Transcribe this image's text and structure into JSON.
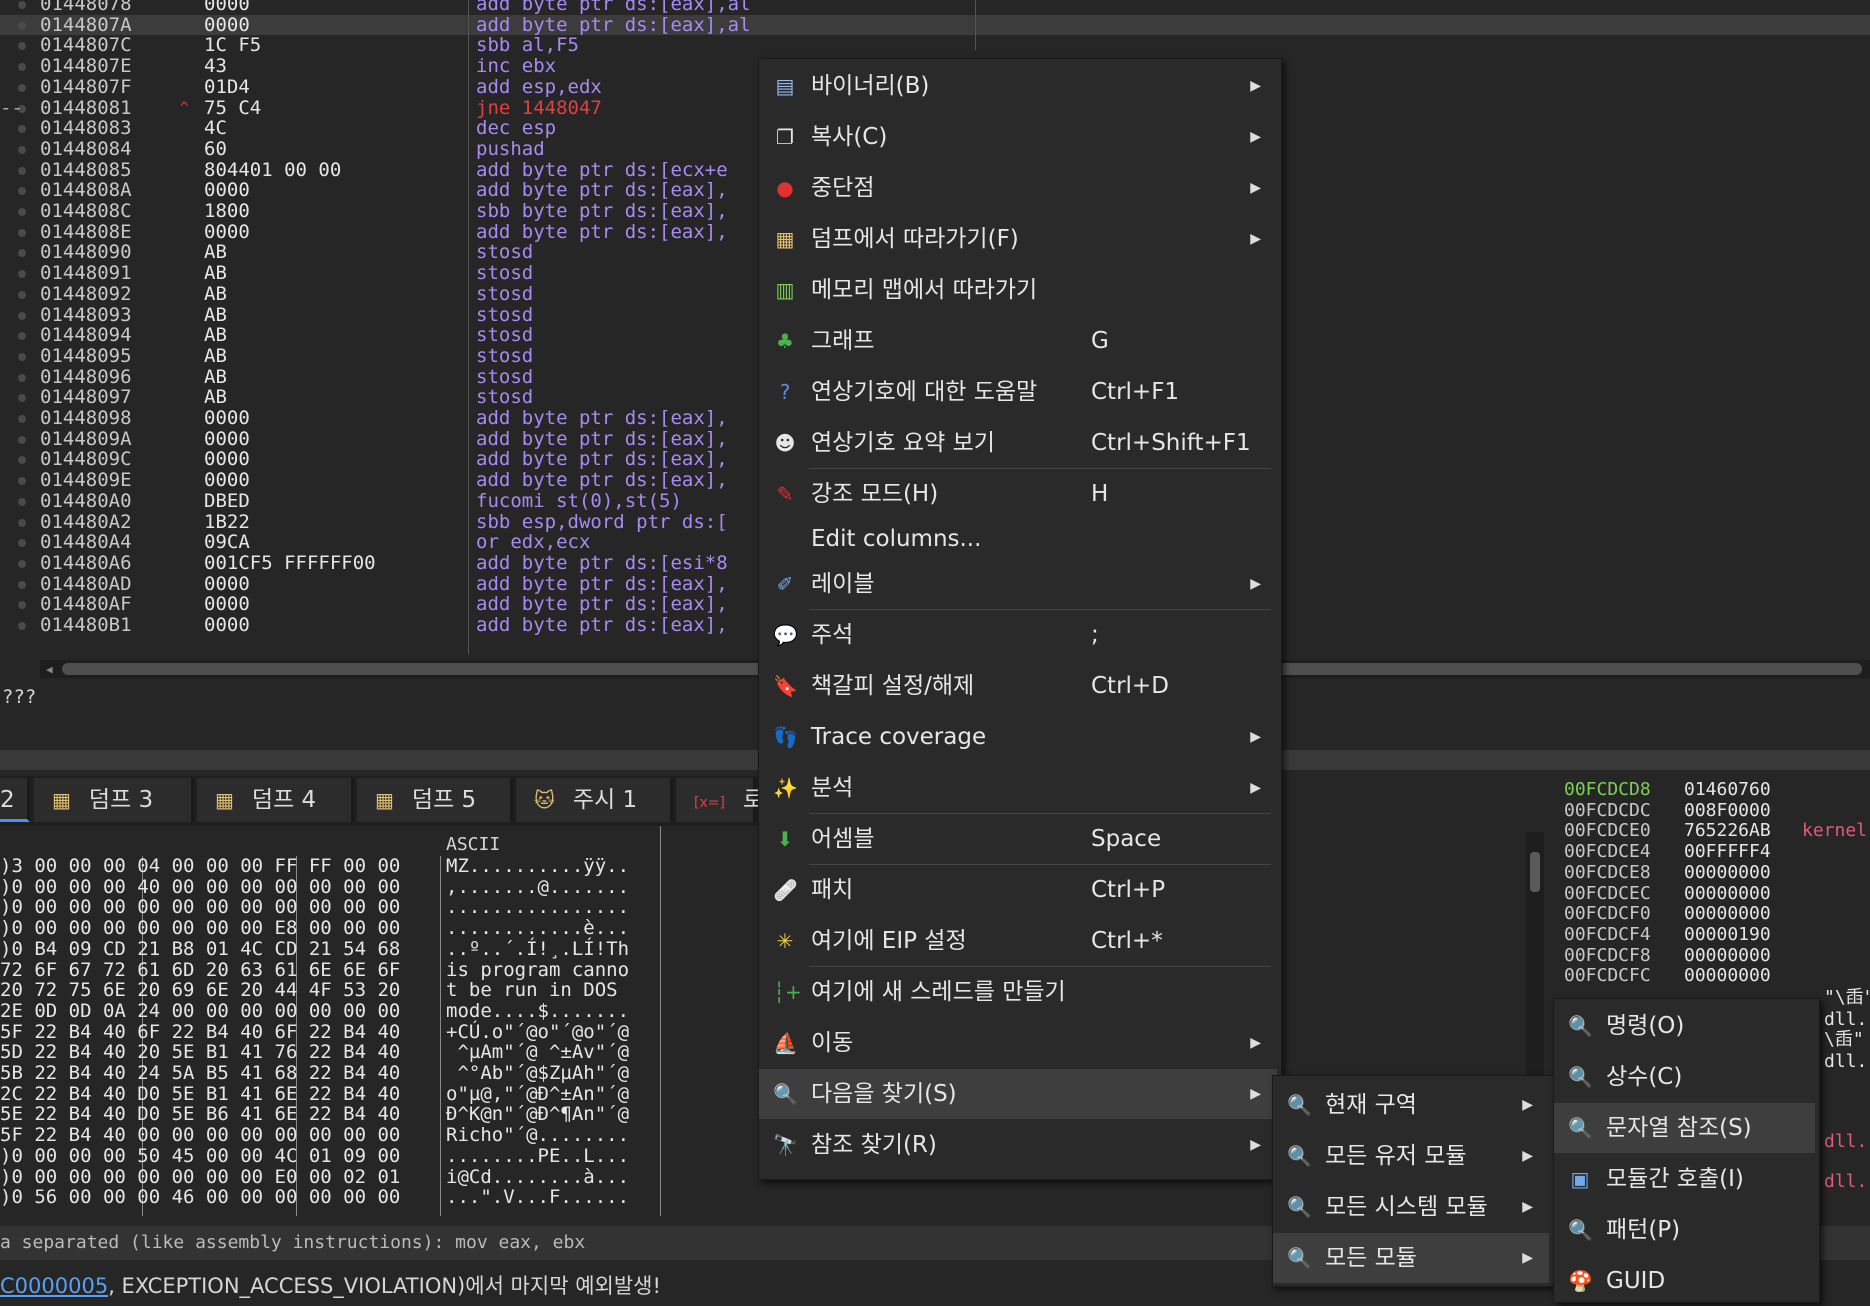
{
  "disassembly": {
    "rows": [
      {
        "addr": "01448078",
        "bytes": "0000",
        "instr": "add byte ptr ds:[eax],al",
        "selected": false,
        "gutter": "",
        "arrow": "",
        "red": false
      },
      {
        "addr": "0144807A",
        "bytes": "0000",
        "instr": "add byte ptr ds:[eax],al",
        "selected": true,
        "gutter": "",
        "arrow": "",
        "red": false
      },
      {
        "addr": "0144807C",
        "bytes": "1C F5",
        "instr": "sbb al,F5",
        "selected": false,
        "gutter": "",
        "arrow": "",
        "red": false
      },
      {
        "addr": "0144807E",
        "bytes": "43",
        "instr": "inc ebx",
        "selected": false,
        "gutter": "",
        "arrow": "",
        "red": false
      },
      {
        "addr": "0144807F",
        "bytes": "01D4",
        "instr": "add esp,edx",
        "selected": false,
        "gutter": "",
        "arrow": "",
        "red": false
      },
      {
        "addr": "01448081",
        "bytes": "75 C4",
        "instr": "jne 1448047",
        "selected": false,
        "gutter": "--",
        "arrow": "^",
        "red": true
      },
      {
        "addr": "01448083",
        "bytes": "4C",
        "instr": "dec esp",
        "selected": false,
        "gutter": "",
        "arrow": "",
        "red": false
      },
      {
        "addr": "01448084",
        "bytes": "60",
        "instr": "pushad",
        "selected": false,
        "gutter": "",
        "arrow": "",
        "red": false
      },
      {
        "addr": "01448085",
        "bytes": "804401 00 00",
        "instr": "add byte ptr ds:[ecx+e",
        "selected": false,
        "gutter": "",
        "arrow": "",
        "red": false
      },
      {
        "addr": "0144808A",
        "bytes": "0000",
        "instr": "add byte ptr ds:[eax],",
        "selected": false,
        "gutter": "",
        "arrow": "",
        "red": false
      },
      {
        "addr": "0144808C",
        "bytes": "1800",
        "instr": "sbb byte ptr ds:[eax],",
        "selected": false,
        "gutter": "",
        "arrow": "",
        "red": false
      },
      {
        "addr": "0144808E",
        "bytes": "0000",
        "instr": "add byte ptr ds:[eax],",
        "selected": false,
        "gutter": "",
        "arrow": "",
        "red": false
      },
      {
        "addr": "01448090",
        "bytes": "AB",
        "instr": "stosd",
        "selected": false,
        "gutter": "",
        "arrow": "",
        "red": false
      },
      {
        "addr": "01448091",
        "bytes": "AB",
        "instr": "stosd",
        "selected": false,
        "gutter": "",
        "arrow": "",
        "red": false
      },
      {
        "addr": "01448092",
        "bytes": "AB",
        "instr": "stosd",
        "selected": false,
        "gutter": "",
        "arrow": "",
        "red": false
      },
      {
        "addr": "01448093",
        "bytes": "AB",
        "instr": "stosd",
        "selected": false,
        "gutter": "",
        "arrow": "",
        "red": false
      },
      {
        "addr": "01448094",
        "bytes": "AB",
        "instr": "stosd",
        "selected": false,
        "gutter": "",
        "arrow": "",
        "red": false
      },
      {
        "addr": "01448095",
        "bytes": "AB",
        "instr": "stosd",
        "selected": false,
        "gutter": "",
        "arrow": "",
        "red": false
      },
      {
        "addr": "01448096",
        "bytes": "AB",
        "instr": "stosd",
        "selected": false,
        "gutter": "",
        "arrow": "",
        "red": false
      },
      {
        "addr": "01448097",
        "bytes": "AB",
        "instr": "stosd",
        "selected": false,
        "gutter": "",
        "arrow": "",
        "red": false
      },
      {
        "addr": "01448098",
        "bytes": "0000",
        "instr": "add byte ptr ds:[eax],",
        "selected": false,
        "gutter": "",
        "arrow": "",
        "red": false
      },
      {
        "addr": "0144809A",
        "bytes": "0000",
        "instr": "add byte ptr ds:[eax],",
        "selected": false,
        "gutter": "",
        "arrow": "",
        "red": false
      },
      {
        "addr": "0144809C",
        "bytes": "0000",
        "instr": "add byte ptr ds:[eax],",
        "selected": false,
        "gutter": "",
        "arrow": "",
        "red": false
      },
      {
        "addr": "0144809E",
        "bytes": "0000",
        "instr": "add byte ptr ds:[eax],",
        "selected": false,
        "gutter": "",
        "arrow": "",
        "red": false
      },
      {
        "addr": "014480A0",
        "bytes": "DBED",
        "instr": "fucomi st(0),st(5)",
        "selected": false,
        "gutter": "",
        "arrow": "",
        "red": false
      },
      {
        "addr": "014480A2",
        "bytes": "1B22",
        "instr": "sbb esp,dword ptr ds:[",
        "selected": false,
        "gutter": "",
        "arrow": "",
        "red": false
      },
      {
        "addr": "014480A4",
        "bytes": "09CA",
        "instr": "or edx,ecx",
        "selected": false,
        "gutter": "",
        "arrow": "",
        "red": false
      },
      {
        "addr": "014480A6",
        "bytes": "001CF5 FFFFFF00",
        "instr": "add byte ptr ds:[esi*8",
        "selected": false,
        "gutter": "",
        "arrow": "",
        "red": false
      },
      {
        "addr": "014480AD",
        "bytes": "0000",
        "instr": "add byte ptr ds:[eax],",
        "selected": false,
        "gutter": "",
        "arrow": "",
        "red": false
      },
      {
        "addr": "014480AF",
        "bytes": "0000",
        "instr": "add byte ptr ds:[eax],",
        "selected": false,
        "gutter": "",
        "arrow": "",
        "red": false
      },
      {
        "addr": "014480B1",
        "bytes": "0000",
        "instr": "add byte ptr ds:[eax],",
        "selected": false,
        "gutter": "",
        "arrow": "",
        "red": false
      }
    ]
  },
  "info": {
    "text": "???"
  },
  "tabs": [
    {
      "label": "2",
      "icon": "",
      "active": true
    },
    {
      "label": "덤프 3",
      "icon": "dump-icon",
      "active": false
    },
    {
      "label": "덤프 4",
      "icon": "dump-icon",
      "active": false
    },
    {
      "label": "덤프 5",
      "icon": "dump-icon",
      "active": false
    },
    {
      "label": "주시 1",
      "icon": "watch-icon",
      "active": false
    },
    {
      "label": "로",
      "icon": "locals-icon",
      "active": false
    }
  ],
  "dump": {
    "ascii_header": "ASCII",
    "rows": [
      {
        "hex": ")3 00 00 00 04 00 00 00 FF FF 00 00",
        "ascii": "MZ..........ÿÿ.."
      },
      {
        "hex": ")0 00 00 00 40 00 00 00 00 00 00 00",
        "ascii": ",.......@......."
      },
      {
        "hex": ")0 00 00 00 00 00 00 00 00 00 00 00",
        "ascii": "................"
      },
      {
        "hex": ")0 00 00 00 00 00 00 00 E8 00 00 00",
        "ascii": "............è..."
      },
      {
        "hex": ")0 B4 09 CD 21 B8 01 4C CD 21 54 68",
        "ascii": "..º..´.Í!¸.LÍ!Th"
      },
      {
        "hex": "72 6F 67 72 61 6D 20 63 61 6E 6E 6F",
        "ascii": "is program canno"
      },
      {
        "hex": "20 72 75 6E 20 69 6E 20 44 4F 53 20",
        "ascii": "t be run in DOS "
      },
      {
        "hex": "2E 0D 0D 0A 24 00 00 00 00 00 00 00",
        "ascii": "mode....$......."
      },
      {
        "hex": "5F 22 B4 40 6F 22 B4 40 6F 22 B4 40",
        "ascii": "+CÚ.o\"´@o\"´@o\"´@"
      },
      {
        "hex": "5D 22 B4 40 20 5E B1 41 76 22 B4 40",
        "ascii": " ^µAm\"´@ ^±Av\"´@"
      },
      {
        "hex": "5B 22 B4 40 24 5A B5 41 68 22 B4 40",
        "ascii": " ^°Ab\"´@$ZµAh\"´@"
      },
      {
        "hex": "2C 22 B4 40 D0 5E B1 41 6E 22 B4 40",
        "ascii": "o\"µ@,\"´@Ð^±An\"´@"
      },
      {
        "hex": "5E 22 B4 40 D0 5E B6 41 6E 22 B4 40",
        "ascii": "Ð^K@n\"´@Ð^¶An\"´@"
      },
      {
        "hex": "5F 22 B4 40 00 00 00 00 00 00 00 00",
        "ascii": "Richo\"´@........"
      },
      {
        "hex": ")0 00 00 00 50 45 00 00 4C 01 09 00",
        "ascii": "........PE..L..."
      },
      {
        "hex": ")0 00 00 00 00 00 00 00 E0 00 02 01",
        "ascii": "i@Cd........à..."
      },
      {
        "hex": ")0 56 00 00 00 46 00 00 00 00 00 00",
        "ascii": "...\".V...F......"
      }
    ]
  },
  "stack": {
    "rows": [
      {
        "addr": "00FCDCD8",
        "val": "01460760",
        "comment": "",
        "hl": true
      },
      {
        "addr": "00FCDCDC",
        "val": "008F0000",
        "comment": "",
        "hl": false
      },
      {
        "addr": "00FCDCE0",
        "val": "765226AB",
        "comment": "kernel",
        "hl": false
      },
      {
        "addr": "00FCDCE4",
        "val": "00FFFFF4",
        "comment": "",
        "hl": false
      },
      {
        "addr": "00FCDCE8",
        "val": "00000000",
        "comment": "",
        "hl": false
      },
      {
        "addr": "00FCDCEC",
        "val": "00000000",
        "comment": "",
        "hl": false
      },
      {
        "addr": "00FCDCF0",
        "val": "00000000",
        "comment": "",
        "hl": false
      },
      {
        "addr": "00FCDCF4",
        "val": "00000190",
        "comment": "",
        "hl": false
      },
      {
        "addr": "00FCDCF8",
        "val": "00000000",
        "comment": "",
        "hl": false
      },
      {
        "addr": "00FCDCFC",
        "val": "00000000",
        "comment": "",
        "hl": false
      }
    ],
    "side_fragments": [
      "\"\\臿\"",
      "dll.",
      "\\臿\"",
      "dll.",
      "dll.",
      "dll."
    ]
  },
  "command_bar": {
    "text": "a separated (like assembly instructions): mov eax, ebx"
  },
  "status": {
    "link": "C0000005",
    "text": ", EXCEPTION_ACCESS_VIOLATION)에서 마지막 예외발생!"
  },
  "context_menu": {
    "items": [
      {
        "label": "바이너리(B)",
        "shortcut": "",
        "submenu": true,
        "icon": "binary-icon",
        "glyph": "▤",
        "color": "#9ab6e6",
        "selected": false
      },
      {
        "label": "복사(C)",
        "shortcut": "",
        "submenu": true,
        "icon": "copy-icon",
        "glyph": "❐",
        "color": "#e6e6e6",
        "selected": false
      },
      {
        "label": "중단점",
        "shortcut": "",
        "submenu": true,
        "icon": "breakpoint-icon",
        "glyph": "●",
        "color": "#e03030",
        "selected": false
      },
      {
        "label": "덤프에서 따라가기(F)",
        "shortcut": "",
        "submenu": true,
        "icon": "dump-follow-icon",
        "glyph": "▦",
        "color": "#e0c070",
        "selected": false
      },
      {
        "label": "메모리 맵에서 따라가기",
        "shortcut": "",
        "submenu": false,
        "icon": "memory-map-icon",
        "glyph": "▥",
        "color": "#7ccf58",
        "selected": false
      },
      {
        "label": "그래프",
        "shortcut": "G",
        "submenu": false,
        "icon": "graph-icon",
        "glyph": "♣",
        "color": "#4caf50",
        "selected": false
      },
      {
        "label": "연상기호에 대한 도움말",
        "shortcut": "Ctrl+F1",
        "submenu": false,
        "icon": "help-icon",
        "glyph": "?",
        "color": "#5a8ee0",
        "selected": false
      },
      {
        "label": "연상기호 요약 보기",
        "shortcut": "Ctrl+Shift+F1",
        "submenu": false,
        "icon": "summary-icon",
        "glyph": "☻",
        "color": "#e6e6e6",
        "selected": false
      },
      {
        "label": "강조 모드(H)",
        "shortcut": "H",
        "submenu": false,
        "icon": "highlight-icon",
        "glyph": "✎",
        "color": "#e03030",
        "selected": false
      },
      {
        "label": "Edit columns...",
        "shortcut": "",
        "submenu": false,
        "icon": "",
        "glyph": "",
        "color": "#e6e6e6",
        "selected": false
      },
      {
        "label": "레이블",
        "shortcut": "",
        "submenu": true,
        "icon": "label-icon",
        "glyph": "✐",
        "color": "#6fa8f0",
        "selected": false
      },
      {
        "label": "주석",
        "shortcut": ";",
        "submenu": false,
        "icon": "comment-icon",
        "glyph": "💬",
        "color": "#e0c050",
        "selected": false
      },
      {
        "label": "책갈피 설정/해제",
        "shortcut": "Ctrl+D",
        "submenu": false,
        "icon": "bookmark-icon",
        "glyph": "🔖",
        "color": "#e04040",
        "selected": false
      },
      {
        "label": "Trace coverage",
        "shortcut": "",
        "submenu": true,
        "icon": "trace-icon",
        "glyph": "👣",
        "color": "#aaaaaa",
        "selected": false
      },
      {
        "label": "분석",
        "shortcut": "",
        "submenu": true,
        "icon": "analysis-icon",
        "glyph": "✨",
        "color": "#e6e6e6",
        "selected": false
      },
      {
        "label": "어셈블",
        "shortcut": "Space",
        "submenu": false,
        "icon": "assemble-icon",
        "glyph": "⬇",
        "color": "#4caf50",
        "selected": false
      },
      {
        "label": "패치",
        "shortcut": "Ctrl+P",
        "submenu": false,
        "icon": "patch-icon",
        "glyph": "🩹",
        "color": "#e0a070",
        "selected": false
      },
      {
        "label": "여기에 EIP 설정",
        "shortcut": "Ctrl+*",
        "submenu": false,
        "icon": "set-eip-icon",
        "glyph": "✳",
        "color": "#f0d040",
        "selected": false
      },
      {
        "label": "여기에 새 스레드를 만들기",
        "shortcut": "",
        "submenu": false,
        "icon": "new-thread-icon",
        "glyph": "┆+",
        "color": "#4caf50",
        "selected": false
      },
      {
        "label": "이동",
        "shortcut": "",
        "submenu": true,
        "icon": "goto-icon",
        "glyph": "⛵",
        "color": "#6fa8f0",
        "selected": false
      },
      {
        "label": "다음을 찾기(S)",
        "shortcut": "",
        "submenu": true,
        "icon": "search-icon",
        "glyph": "🔍",
        "color": "#cccccc",
        "selected": true
      },
      {
        "label": "참조 찾기(R)",
        "shortcut": "",
        "submenu": true,
        "icon": "references-icon",
        "glyph": "🔭",
        "color": "#cccccc",
        "selected": false
      }
    ]
  },
  "submenu_search": {
    "items": [
      {
        "label": "현재 구역",
        "submenu": true,
        "icon": "magnifier-icon",
        "selected": false
      },
      {
        "label": "모든 유저 모듈",
        "submenu": true,
        "icon": "magnifier-icon",
        "selected": false
      },
      {
        "label": "모든 시스템 모듈",
        "submenu": true,
        "icon": "magnifier-icon",
        "selected": false
      },
      {
        "label": "모든 모듈",
        "submenu": true,
        "icon": "magnifier-icon",
        "selected": true
      }
    ]
  },
  "submenu_modules": {
    "items": [
      {
        "label": "명령(O)",
        "icon": "command-search-icon",
        "glyph": "🔍",
        "color": "#cccccc",
        "selected": false
      },
      {
        "label": "상수(C)",
        "icon": "constant-search-icon",
        "glyph": "🔍",
        "color": "#cccccc",
        "selected": false
      },
      {
        "label": "문자열 참조(S)",
        "icon": "string-search-icon",
        "glyph": "🔍",
        "color": "#cccccc",
        "selected": true
      },
      {
        "label": "모듈간 호출(I)",
        "icon": "intermodular-call-icon",
        "glyph": "▣",
        "color": "#6fa8f0",
        "selected": false
      },
      {
        "label": "패턴(P)",
        "icon": "pattern-search-icon",
        "glyph": "🔍",
        "color": "#cccccc",
        "selected": false
      },
      {
        "label": "GUID",
        "icon": "guid-icon",
        "glyph": "🍄",
        "color": "#e08050",
        "selected": false
      }
    ]
  }
}
